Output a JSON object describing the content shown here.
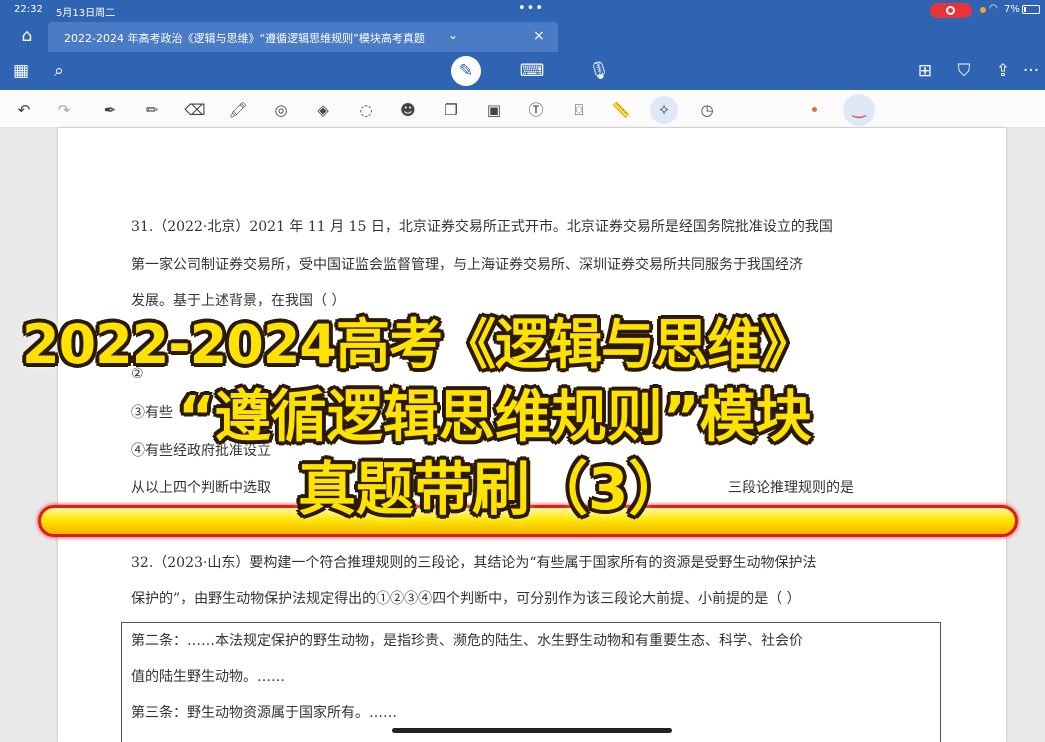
{
  "status_bar": {
    "time": "22:32",
    "date": "5月13日周二",
    "dots": "•••",
    "battery": "7%"
  },
  "tabs": {
    "home_icon": "home-icon",
    "document_title": "2022-2024 年高考政治《逻辑与思维》“遵循逻辑思维规则”模块高考真题",
    "chevron": "⌄",
    "close": "×"
  },
  "toolbar_top": {
    "icons": [
      "grid-icon",
      "search-icon",
      "pen-icon",
      "keyboard-icon",
      "microphone-icon",
      "add-page-icon",
      "bookmark-icon",
      "share-icon",
      "more-icon"
    ],
    "more_label": "···"
  },
  "toolbar_tools": {
    "icons": [
      "undo-icon",
      "redo-icon",
      "pen-tool-icon",
      "pencil-icon",
      "eraser-icon",
      "highlighter-icon",
      "lasso-icon",
      "shapes-icon",
      "comment-icon",
      "sticker-icon",
      "copy-icon",
      "image-icon",
      "text-icon",
      "camera-icon",
      "ruler-icon",
      "laser-icon",
      "timer-icon"
    ]
  },
  "document": {
    "q31_line1": "31.（2022·北京）2021 年 11 月 15 日，北京证券交易所正式开市。北京证券交易所是经国务院批准设立的我国",
    "q31_line2": "第一家公司制证券交易所，受中国证监会监督管理，与上海证券交易所、深圳证券交易所共同服务于我国经济",
    "q31_line3": "发展。基于上述背景，在我国（  ）",
    "opt2": "②",
    "opt3": "③有些",
    "opt4": "④有些经政府批准设立",
    "q31_tail_left": "从以上四个判断中选取",
    "q31_tail_right": "三段论推理规则的是",
    "q32_line1": "32.（2023·山东）要构建一个符合推理规则的三段论，其结论为“有些属于国家所有的资源是受野生动物保护法",
    "q32_line2": "保护的”，由野生动物保护法规定得出的①②③④四个判断中，可分别作为该三段论大前提、小前提的是（   ）",
    "clause2_line1": "第二条：……本法规定保护的野生动物，是指珍贵、濒危的陆生、水生野生动物和有重要生态、科学、社会价",
    "clause2_line2": "值的陆生野生动物。……",
    "clause3": "第三条：野生动物资源属于国家所有。……"
  },
  "overlay": {
    "line1": "2022-2024高考《逻辑与思维》",
    "line2": "“遵循逻辑思维规则”模块",
    "line3": "真题带刷（3）"
  }
}
